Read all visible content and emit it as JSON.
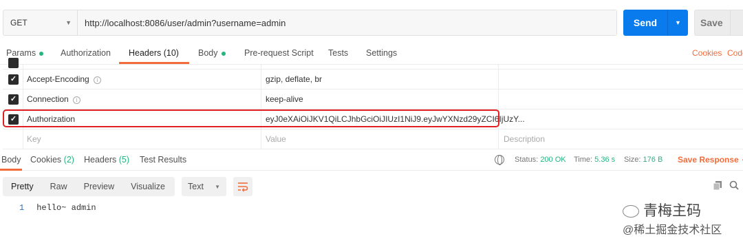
{
  "request": {
    "method": "GET",
    "url": "http://localhost:8086/user/admin?username=admin",
    "send_label": "Send",
    "save_label": "Save"
  },
  "request_tabs": [
    {
      "label": "Params",
      "dot": true
    },
    {
      "label": "Authorization"
    },
    {
      "label": "Headers (10)",
      "active": true
    },
    {
      "label": "Body",
      "dot": true
    },
    {
      "label": "Pre-request Script"
    },
    {
      "label": "Tests"
    },
    {
      "label": "Settings"
    }
  ],
  "links": {
    "cookies": "Cookies",
    "code": "Code"
  },
  "headers": [
    {
      "key": "Accept-Encoding",
      "value": "gzip, deflate, br",
      "info": true,
      "checked": true
    },
    {
      "key": "Connection",
      "value": "keep-alive",
      "info": true,
      "checked": true
    },
    {
      "key": "Authorization",
      "value": "eyJ0eXAiOiJKV1QiLCJhbGciOiJIUzI1NiJ9.eyJwYXNzd29yZCI6IjUzY...",
      "info": false,
      "checked": true,
      "highlighted": true
    }
  ],
  "placeholders": {
    "key": "Key",
    "value": "Value",
    "description": "Description"
  },
  "response_tabs": [
    {
      "label": "Body",
      "active": true
    },
    {
      "label": "Cookies",
      "count": "(2)"
    },
    {
      "label": "Headers",
      "count": "(5)"
    },
    {
      "label": "Test Results"
    }
  ],
  "status": {
    "status_label": "Status:",
    "status_value": "200 OK",
    "time_label": "Time:",
    "time_value": "5.36 s",
    "size_label": "Size:",
    "size_value": "176 B",
    "save_response": "Save Response"
  },
  "response_views": [
    "Pretty",
    "Raw",
    "Preview",
    "Visualize"
  ],
  "format": "Text",
  "response_body": [
    {
      "line": "1",
      "text": "hello~ admin"
    }
  ],
  "watermark": {
    "line1": "青梅主码",
    "line2": "@稀土掘金技术社区"
  },
  "colors": {
    "accent": "#f26b3a",
    "send": "#097bed",
    "success": "#26b47f",
    "highlight": "#e02020"
  },
  "icons": [
    "info-icon",
    "globe-icon",
    "copy-icon",
    "search-icon",
    "wrap-lines-icon",
    "checkbox-icon"
  ]
}
